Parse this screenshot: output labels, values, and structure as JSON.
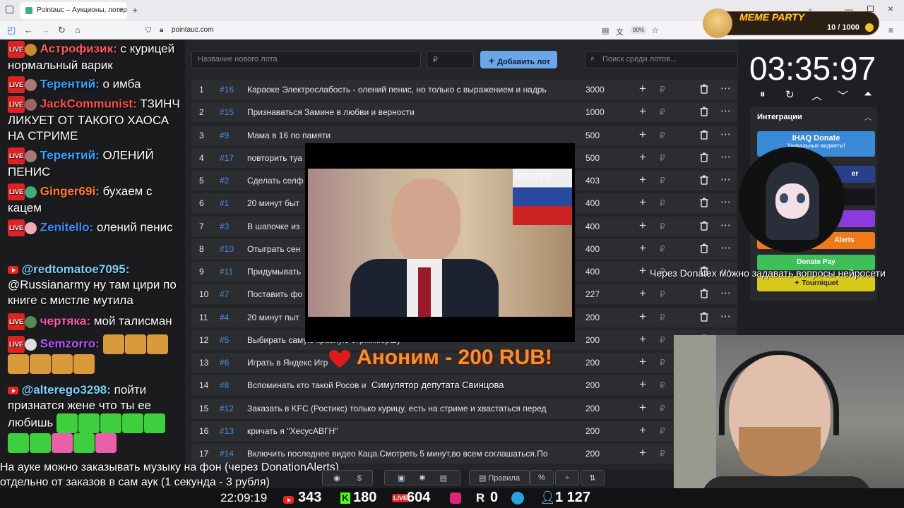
{
  "browser": {
    "tab_title": "Pointauc – Аукционы, лотереи",
    "url": "pointauc.com",
    "zoom": "90%"
  },
  "meme_party": {
    "title": "MEME PARTY",
    "counter": "10 / 1000"
  },
  "app": {
    "new_lot_placeholder": "Название нового лота",
    "amount_placeholder": "₽",
    "add_label": "Добавить лот",
    "search_placeholder": "Поиск среди лотов...",
    "currency": "₽",
    "lots": [
      {
        "n": "1",
        "id": "#16",
        "name": "Караоке Электрослабость - олений пенис, но только с выражением и надрь",
        "amount": "3000"
      },
      {
        "n": "2",
        "id": "#15",
        "name": "Признаваться Замине в любви и верности",
        "amount": "1000"
      },
      {
        "n": "3",
        "id": "#9",
        "name": "Мама в 16 по памяти",
        "amount": "500"
      },
      {
        "n": "4",
        "id": "#17",
        "name": "повторить туа",
        "amount": "500"
      },
      {
        "n": "5",
        "id": "#2",
        "name": "Сделать селф",
        "amount": "403"
      },
      {
        "n": "6",
        "id": "#1",
        "name": "20 минут быт",
        "amount": "400"
      },
      {
        "n": "7",
        "id": "#3",
        "name": "В шапочке из",
        "amount": "400"
      },
      {
        "n": "8",
        "id": "#10",
        "name": "Отыграть сен",
        "amount": "400"
      },
      {
        "n": "9",
        "id": "#11",
        "name": "Придумывать",
        "amount": "400"
      },
      {
        "n": "10",
        "id": "#7",
        "name": "Поставить фо",
        "amount": "227"
      },
      {
        "n": "11",
        "id": "#4",
        "name": "20 минут пыт",
        "amount": "200"
      },
      {
        "n": "12",
        "id": "#5",
        "name": "Выбирать самую красную стриммершу",
        "amount": "200"
      },
      {
        "n": "13",
        "id": "#6",
        "name": "Играть в Яндекс Игр",
        "amount": "200"
      },
      {
        "n": "14",
        "id": "#8",
        "name": "Вспоминать кто такой Росов и",
        "amount": "200"
      },
      {
        "n": "15",
        "id": "#12",
        "name": "Заказать в KFC (Ростикс) только курицу, есть на стриме и хвастаться перед",
        "amount": "200"
      },
      {
        "n": "16",
        "id": "#13",
        "name": "кричать я \"ХесусАВГН\"",
        "amount": "200"
      },
      {
        "n": "17",
        "id": "#14",
        "name": "Включить последнее видео Каца.Смотреть 5 минут,во всем соглашаться.По",
        "amount": "200"
      }
    ]
  },
  "timer": {
    "value": "03:35:97"
  },
  "integrations": {
    "title": "Интеграции",
    "ihaq_title": "IHAQ Donate",
    "ihaq_sub": "Уникальные виджеты!",
    "alerts": "Alerts",
    "donatepay": "Donate Pay",
    "tourniquet": "Tourniquet",
    "partial": "er"
  },
  "chat": [
    {
      "user": "Астрофизик:",
      "color": "#ff5a5a",
      "text": " с курицей нормальный варик",
      "src": "live"
    },
    {
      "user": "Терентий:",
      "color": "#3aa0ff",
      "text": " о имба",
      "src": "live"
    },
    {
      "user": "JackCommunist:",
      "color": "#ff4d4d",
      "text": " ТЗИНЧ ЛИКУЕТ ОТ ТАКОГО ХАОСА НА СТРИМЕ",
      "src": "live"
    },
    {
      "user": "Терентий:",
      "color": "#3aa0ff",
      "text": " ОЛЕНИЙ ПЕНИС",
      "src": "live"
    },
    {
      "user": "Ginger69i:",
      "color": "#ff7a3a",
      "text": " бухаем с кацем",
      "src": "live"
    },
    {
      "user": "Zenitello:",
      "color": "#3a8bff",
      "text": " олений пенис",
      "src": "live"
    },
    {
      "user": "@redtomatoe7095:",
      "color": "#7fd0ff",
      "text": " @Russianarmy ну там цири по книге с мистле мутила",
      "src": "yt"
    },
    {
      "user": "чертяка:",
      "color": "#ff5ab0",
      "text": " мой талисман",
      "src": "live"
    },
    {
      "user": "Semzorro:",
      "color": "#b455ff",
      "text": "",
      "src": "live"
    },
    {
      "user": "@alterego3298:",
      "color": "#7fd0ff",
      "text": " пойти признатся жене что ты ее любишь",
      "src": "yt"
    }
  ],
  "overlay": {
    "donation": "Аноним - 200 RUB!",
    "donation_sub": "Симулятор депутата Свинцова",
    "video_watermark": "bazava",
    "ticker": "Через Donatex можно задавать вопросы нейросети",
    "note_line1": "На ауке можно заказывать музыку на фон (через DonationAlerts)",
    "note_line2": "отдельно от заказов в сам аук (1 секунда - 3 рубля)",
    "rules_label": "Правила"
  },
  "stats": {
    "clock": "22:09:19",
    "youtube": "343",
    "kick": "180",
    "vklive": "604",
    "rutube": "0",
    "total": "1 127"
  },
  "colors": {
    "accent": "#6aa6e8",
    "donate_orange": "#f0913a",
    "ihaq": "#3a8ad8",
    "alerts": "#f07a1a",
    "donatepay": "#3fbf5a",
    "tourniquet": "#d8c81a",
    "purple": "#8a3ae0"
  }
}
